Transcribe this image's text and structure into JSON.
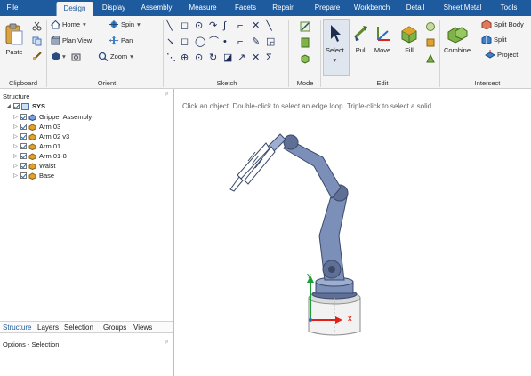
{
  "menubar": {
    "tabs": [
      "File",
      "Design",
      "Display",
      "Assembly",
      "Measure",
      "Facets",
      "Repair",
      "Prepare",
      "Workbench",
      "Detail",
      "Sheet Metal",
      "Tools"
    ],
    "active": "Design"
  },
  "ribbon": {
    "clipboard": {
      "label": "Clipboard",
      "paste": "Paste"
    },
    "orient": {
      "label": "Orient",
      "home": "Home",
      "spin": "Spin",
      "plan_view": "Plan View",
      "pan": "Pan",
      "zoom": "Zoom"
    },
    "sketch": {
      "label": "Sketch"
    },
    "mode": {
      "label": "Mode"
    },
    "edit": {
      "label": "Edit",
      "select": "Select",
      "pull": "Pull",
      "move": "Move",
      "fill": "Fill"
    },
    "intersect": {
      "label": "Intersect",
      "combine": "Combine",
      "split_body": "Split Body",
      "split": "Split",
      "project": "Project"
    }
  },
  "structure": {
    "title": "Structure",
    "root": "SYS",
    "items": [
      "Gripper Assembly",
      "Arm 03",
      "Arm 02 v3",
      "Arm 01",
      "Arm 01-8",
      "Waist",
      "Base"
    ]
  },
  "panel_tabs": [
    "Structure",
    "Layers",
    "Selection",
    "Groups",
    "Views"
  ],
  "options": {
    "title": "Options - Selection"
  },
  "viewport": {
    "hint": "Click an object. Double-click to select an edge loop. Triple-click to select a solid.",
    "axis_y": "Y",
    "axis_x": "X"
  },
  "colors": {
    "menubar": "#1e5a9e",
    "robot": "#7b8fb8",
    "axis_x": "#e0201b",
    "axis_y": "#1aa034"
  }
}
